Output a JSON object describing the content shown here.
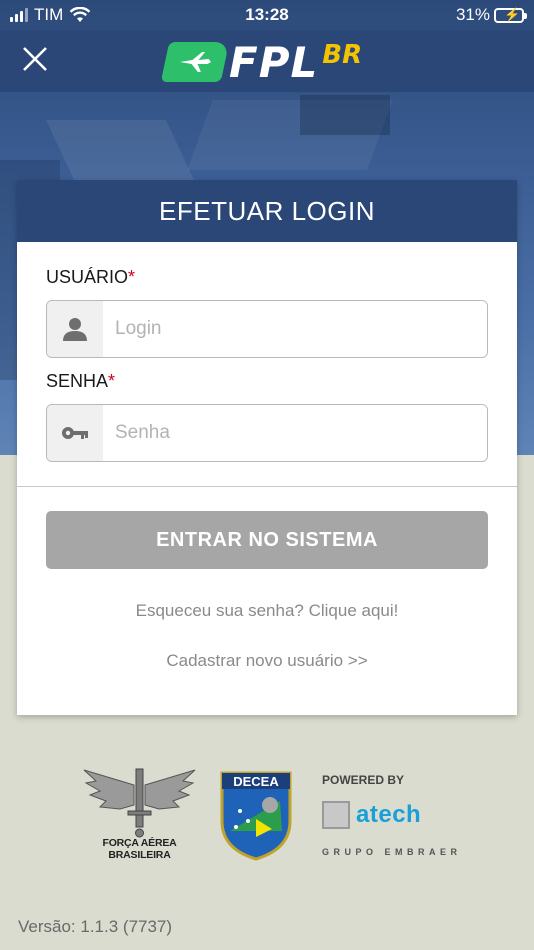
{
  "statusbar": {
    "carrier": "TIM",
    "time": "13:28",
    "battery": "31%",
    "battery_level": 0.31
  },
  "header": {
    "logo_main": "FPL",
    "logo_suffix": "BR"
  },
  "login": {
    "title": "EFETUAR LOGIN",
    "user_label": "USUÁRIO",
    "user_placeholder": "Login",
    "pass_label": "SENHA",
    "pass_placeholder": "Senha",
    "required_mark": "*",
    "submit_label": "ENTRAR NO SISTEMA",
    "forgot_link": "Esqueceu sua senha? Clique aqui!",
    "register_link": "Cadastrar novo usuário >>"
  },
  "footer": {
    "fab_caption": "FORÇA AÉREA BRASILEIRA",
    "decea_label": "DECEA",
    "powered_by": "POWERED BY",
    "atech_brand": "atech",
    "atech_group": "GRUPO EMBRAER",
    "version": "Versão: 1.1.3 (7737)"
  },
  "colors": {
    "navbar": "#2b4777",
    "button_disabled": "#a6a6a6",
    "required": "#d0021b",
    "logo_green": "#2dbf6a",
    "logo_yellow": "#f4c400",
    "atech_blue": "#1aa0d8"
  }
}
